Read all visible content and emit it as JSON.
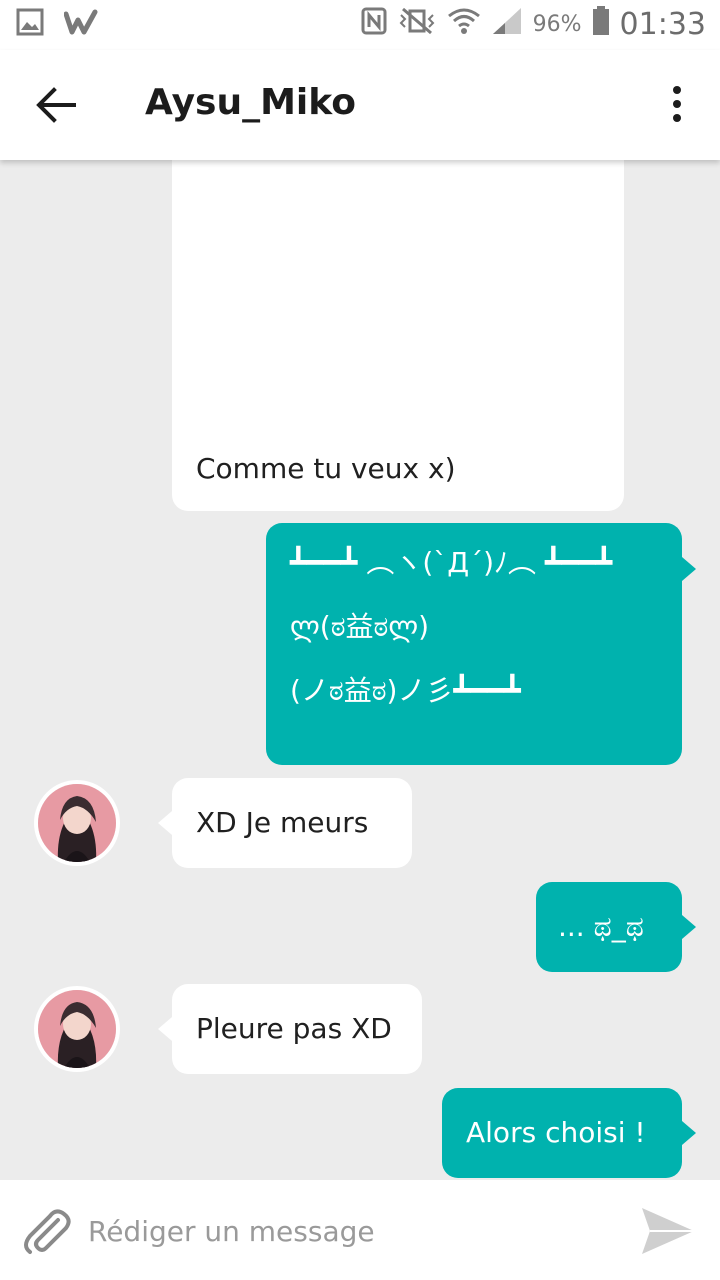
{
  "status_bar": {
    "battery": "96%",
    "time": "01:33"
  },
  "header": {
    "title": "Aysu_Miko"
  },
  "messages": [
    {
      "side": "in",
      "text": "Comme tu veux x)"
    },
    {
      "side": "out",
      "lines": [
        "┻━━┻ ︵ヽ(`Д´)ﾉ︵ ┻━━┻",
        "ლ(ಠ益ಠლ)",
        "(ノಠ益ಠ)ノ彡┻━━┻"
      ]
    },
    {
      "side": "in",
      "text": "XD Je meurs"
    },
    {
      "side": "out",
      "text": "... ಥ_ಥ"
    },
    {
      "side": "in",
      "text": "Pleure pas XD"
    },
    {
      "side": "out",
      "text": "Alors choisi !"
    }
  ],
  "composer": {
    "placeholder": "Rédiger un message"
  },
  "colors": {
    "outgoing_bubble": "#00b2ae",
    "incoming_bubble": "#ffffff",
    "chat_background": "#ececec"
  }
}
